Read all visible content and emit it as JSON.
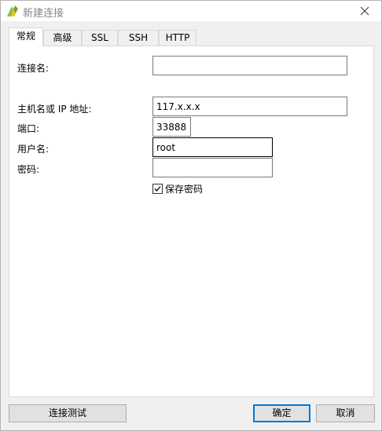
{
  "window": {
    "title": "新建连接"
  },
  "tabs": [
    {
      "label": "常规",
      "active": true
    },
    {
      "label": "高级",
      "active": false
    },
    {
      "label": "SSL",
      "active": false
    },
    {
      "label": "SSH",
      "active": false
    },
    {
      "label": "HTTP",
      "active": false
    }
  ],
  "form": {
    "connection_name": {
      "label": "连接名:",
      "value": ""
    },
    "host": {
      "label": "主机名或 IP 地址:",
      "value": "117.x.x.x"
    },
    "port": {
      "label": "端口:",
      "value": "33888"
    },
    "username": {
      "label": "用户名:",
      "value": "root"
    },
    "password": {
      "label": "密码:",
      "value": ""
    },
    "save_password": {
      "label": "保存密码",
      "checked": true
    }
  },
  "buttons": {
    "test": "连接测试",
    "ok": "确定",
    "cancel": "取消"
  },
  "icons": {
    "app": "navicat-connection-icon",
    "close": "close-icon",
    "check": "checkmark-icon"
  },
  "colors": {
    "default_button_border": "#0078d7",
    "dialog_background": "#f0f0f0",
    "title_text": "#888888"
  }
}
